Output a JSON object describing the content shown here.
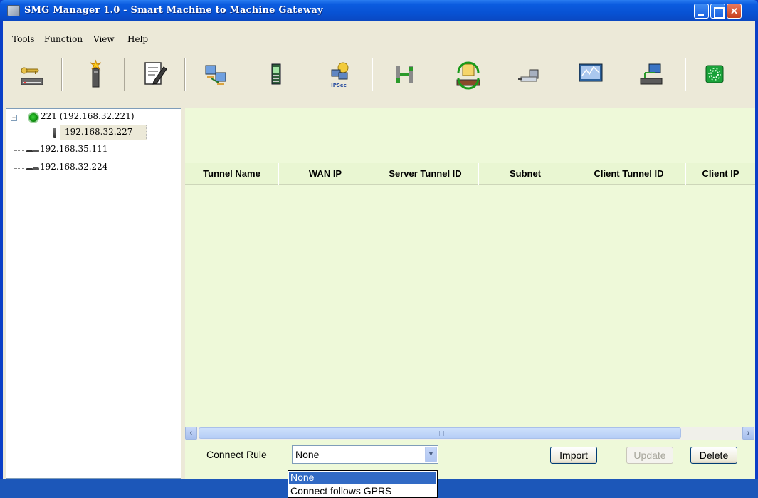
{
  "window": {
    "title": "SMG Manager 1.0 - Smart Machine to Machine Gateway",
    "controls": [
      "minimize",
      "maximize",
      "close"
    ]
  },
  "menu": {
    "items": [
      {
        "label": "Tools"
      },
      {
        "label": "Function"
      },
      {
        "label": "View"
      },
      {
        "label": "Help"
      }
    ]
  },
  "toolbar": {
    "icons": [
      "key-device-icon",
      "flash-device-icon",
      "edit-note-icon",
      "network-computers-icon",
      "mobile-device-icon",
      "ipsec-icon",
      "network-topology-icon",
      "sync-tray-icon",
      "usb-device-icon",
      "monitor-graph-icon",
      "network-station-icon",
      "green-gear-icon"
    ],
    "ipsec_text": "IPSec"
  },
  "tree": {
    "root": "221 (192.168.32.221)",
    "children": [
      {
        "label": "192.168.32.227",
        "icon": "stick-device-icon",
        "selected": true
      },
      {
        "label": "192.168.35.111",
        "icon": "plug-icon",
        "selected": false
      },
      {
        "label": "192.168.32.224",
        "icon": "plug-icon",
        "selected": false
      }
    ]
  },
  "table": {
    "columns": [
      "Tunnel Name",
      "WAN IP",
      "Server Tunnel ID",
      "Subnet",
      "Client Tunnel ID",
      "Client IP"
    ],
    "rows": []
  },
  "bottom": {
    "connect_rule_label": "Connect Rule",
    "connect_rule_value": "None",
    "import_label": "Import",
    "update_label": "Update",
    "delete_label": "Delete"
  },
  "dropdown": {
    "options": [
      "None",
      "Connect follows GPRS"
    ],
    "selected": "None"
  },
  "colors": {
    "title_bar": "#0852d4",
    "panel_bg": "#eef9d9",
    "window_bg": "#ece9d8",
    "selection": "#316ac5"
  }
}
